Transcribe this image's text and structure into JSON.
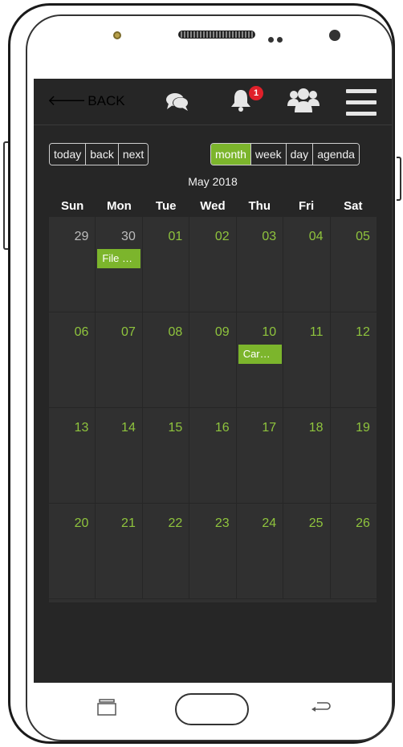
{
  "header": {
    "back_label": "BACK",
    "notification_count": "1",
    "icons": [
      "chat-icon",
      "bell-icon",
      "users-icon",
      "menu-icon"
    ]
  },
  "toolbar": {
    "nav_buttons": [
      "today",
      "back",
      "next"
    ],
    "view_buttons": [
      "month",
      "week",
      "day",
      "agenda"
    ],
    "active_view": "month"
  },
  "calendar": {
    "title": "May 2018",
    "weekdays": [
      "Sun",
      "Mon",
      "Tue",
      "Wed",
      "Thu",
      "Fri",
      "Sat"
    ],
    "weeks": [
      [
        "29",
        "30",
        "01",
        "02",
        "03",
        "04",
        "05"
      ],
      [
        "06",
        "07",
        "08",
        "09",
        "10",
        "11",
        "12"
      ],
      [
        "13",
        "14",
        "15",
        "16",
        "17",
        "18",
        "19"
      ],
      [
        "20",
        "21",
        "22",
        "23",
        "24",
        "25",
        "26"
      ]
    ],
    "events": [
      {
        "week": 0,
        "day": 1,
        "label": "File …"
      },
      {
        "week": 1,
        "day": 4,
        "label": "Car…"
      }
    ]
  },
  "colors": {
    "accent": "#7cb52c",
    "screen_bg": "#262626",
    "cell_bg": "#303030",
    "badge": "#e0202a"
  }
}
